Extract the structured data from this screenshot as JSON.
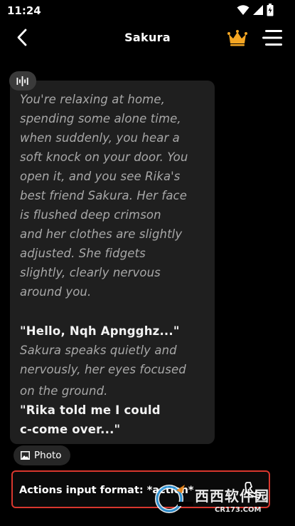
{
  "status_bar": {
    "time": "11:24",
    "icons": [
      "wifi-icon",
      "signal-icon",
      "battery-icon"
    ]
  },
  "header": {
    "title": "Sakura",
    "back_icon": "chevron-left-icon",
    "crown_icon": "crown-icon",
    "menu_icon": "menu-icon"
  },
  "message": {
    "audio_icon": "audio-wave-icon",
    "narration_1": [
      "You're relaxing at home,",
      "spending some alone time,",
      "when suddenly, you hear a",
      "soft knock on your door. You",
      "open it, and you see Rika's",
      "best friend Sakura. Her face",
      "is flushed deep crimson",
      "and her clothes are slightly",
      "adjusted. She fidgets",
      "slightly, clearly nervous",
      "around you."
    ],
    "dialogue_1": "\"Hello, Nqh Apngghz...\"",
    "narration_2": [
      "Sakura speaks quietly and",
      "nervously, her eyes focused",
      "on the ground."
    ],
    "dialogue_2": [
      "\"Rika told me I could",
      "c-come over...\""
    ]
  },
  "photo_button": {
    "label": "Photo",
    "icon": "image-icon"
  },
  "input": {
    "placeholder": "Actions input format: *action*",
    "call_icon": "phone-icon"
  },
  "watermark": {
    "text_cn": "西西软件园",
    "url": "CR173.COM"
  },
  "colors": {
    "accent_border": "#d9372e",
    "crown": "#f5a623",
    "bubble_bg": "#1f1f1f",
    "narration": "#a8a8a8"
  }
}
